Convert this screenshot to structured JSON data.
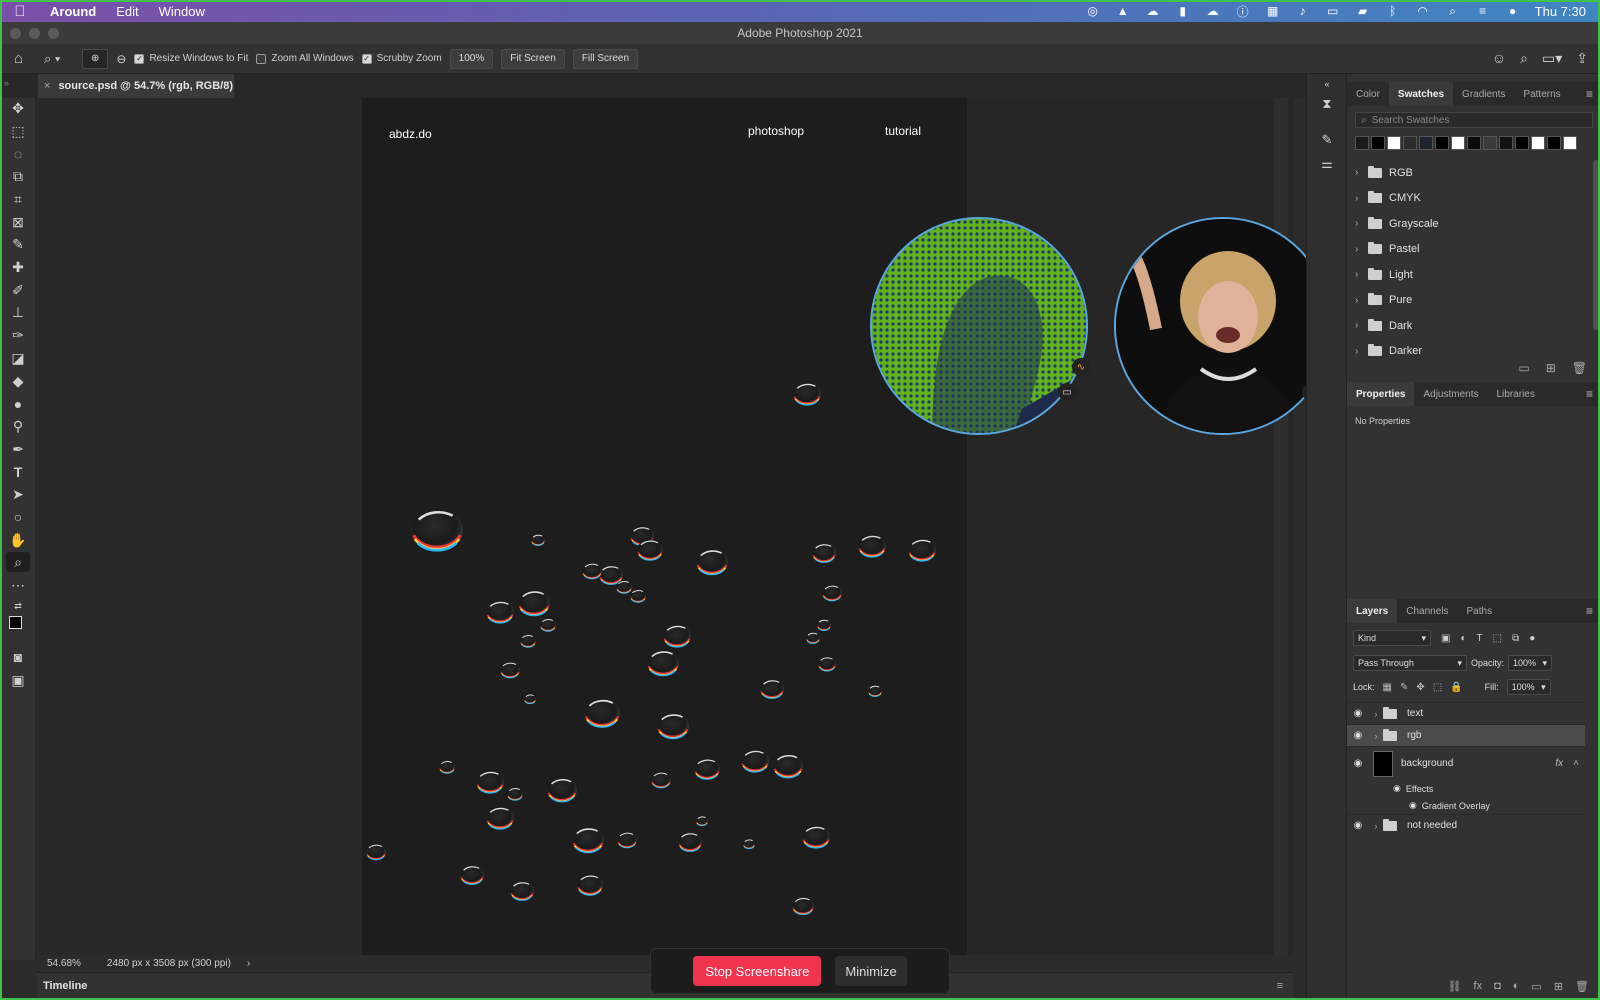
{
  "menubar": {
    "app": "Around",
    "items": [
      "Edit",
      "Window"
    ],
    "clock": "Thu 7:30"
  },
  "window": {
    "title": "Adobe Photoshop 2021"
  },
  "options": {
    "resize_label": "Resize Windows to Fit",
    "resize_checked": true,
    "zoom_all_label": "Zoom All Windows",
    "zoom_all_checked": false,
    "scrubby_label": "Scrubby Zoom",
    "scrubby_checked": true,
    "zoom_value": "100%",
    "fit_screen": "Fit Screen",
    "fill_screen": "Fill Screen"
  },
  "document": {
    "tab": "source.psd @ 54.7% (rgb, RGB/8)",
    "close": "×",
    "brand": "abdz.do",
    "nav_1": "photoshop",
    "nav_2": "tutorial"
  },
  "status": {
    "zoom": "54.68%",
    "size": "2480 px x 3508 px (300 ppi)",
    "arrow": "›"
  },
  "timeline": {
    "label": "Timeline"
  },
  "swatches_panel": {
    "tabs": [
      "Color",
      "Swatches",
      "Gradients",
      "Patterns"
    ],
    "active_tab": "Swatches",
    "search_placeholder": "Search Swatches",
    "swatch_colors": [
      "#1a1a1a",
      "#000000",
      "#ffffff",
      "#2b2b2b",
      "#1e2430",
      "#000000",
      "#ffffff",
      "#0a0a0a",
      "#3a3a3a",
      "#111111",
      "#000000",
      "#ffffff",
      "#000000",
      "#ffffff"
    ],
    "folders": [
      "RGB",
      "CMYK",
      "Grayscale",
      "Pastel",
      "Light",
      "Pure",
      "Dark",
      "Darker"
    ]
  },
  "properties_panel": {
    "tabs": [
      "Properties",
      "Adjustments",
      "Libraries"
    ],
    "active_tab": "Properties",
    "empty_text": "No Properties"
  },
  "layers_panel": {
    "tabs": [
      "Layers",
      "Channels",
      "Paths"
    ],
    "active_tab": "Layers",
    "filter_kind": "Kind",
    "blend_mode": "Pass Through",
    "opacity_label": "Opacity:",
    "opacity": "100%",
    "lock_label": "Lock:",
    "fill_label": "Fill:",
    "fill": "100%",
    "layers": [
      {
        "name": "text",
        "type": "group"
      },
      {
        "name": "rgb",
        "type": "group",
        "selected": true
      },
      {
        "name": "background",
        "type": "layer",
        "fx": "fx"
      },
      {
        "name": "not needed",
        "type": "group"
      }
    ],
    "effects_label": "Effects",
    "effect_name": "Gradient Overlay"
  },
  "screenshare": {
    "stop": "Stop Screenshare",
    "minimize": "Minimize"
  },
  "colors": {
    "accent_stop": "#f0344f",
    "bubble_ring": "#5aa7e0",
    "frame": "#3ec24a"
  }
}
